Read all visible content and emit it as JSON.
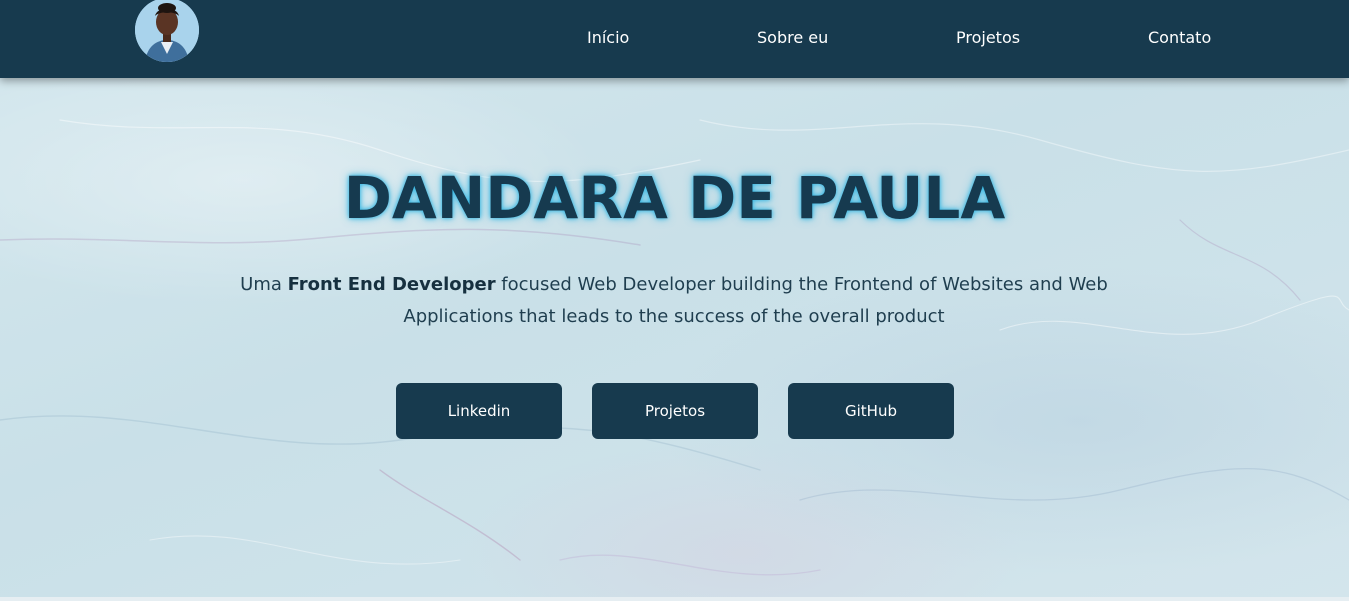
{
  "colors": {
    "navbar_bg": "#173a4e",
    "page_bg": "#d2e6ec",
    "title_glow": "#2fb5e3",
    "button_bg": "#173a4e"
  },
  "navbar": {
    "avatar_icon": "profile-photo",
    "links": [
      {
        "label": "Início"
      },
      {
        "label": "Sobre eu"
      },
      {
        "label": "Projetos"
      },
      {
        "label": "Contato"
      }
    ]
  },
  "hero": {
    "title": "DANDARA DE PAULA",
    "desc_prefix": "Uma ",
    "desc_bold": "Front End Developer",
    "desc_suffix": " focused Web Developer building the Frontend of Websites and Web Applications that leads to the success of the overall product",
    "buttons": [
      {
        "label": "Linkedin"
      },
      {
        "label": "Projetos"
      },
      {
        "label": "GitHub"
      }
    ]
  }
}
